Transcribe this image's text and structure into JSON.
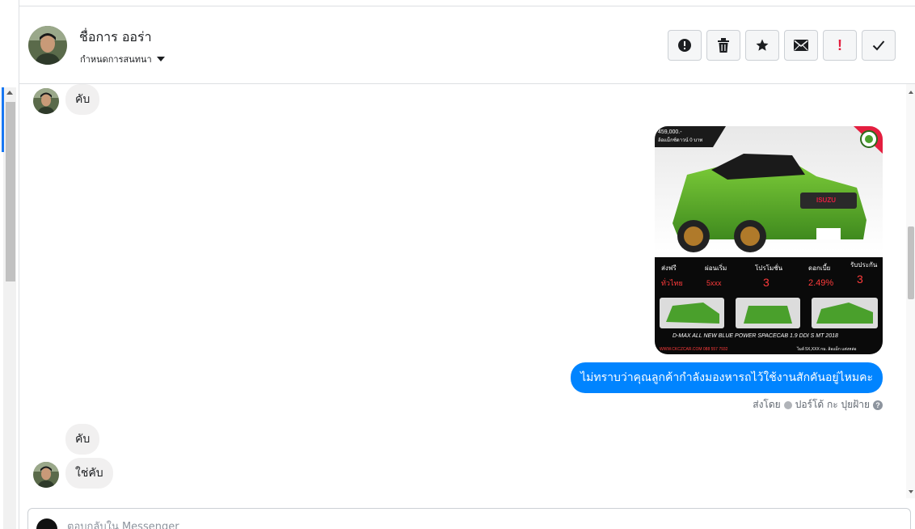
{
  "header": {
    "contact_name": "ชื่อการ ออร่า",
    "assign_label": "กำหนดการสนทนา"
  },
  "actions": [
    {
      "name": "report-spam-button",
      "icon": "alert-circle-icon"
    },
    {
      "name": "delete-button",
      "icon": "trash-icon"
    },
    {
      "name": "star-button",
      "icon": "star-icon"
    },
    {
      "name": "mark-unread-button",
      "icon": "envelope-icon"
    },
    {
      "name": "follow-up-button",
      "icon": "exclamation-icon"
    },
    {
      "name": "mark-done-button",
      "icon": "checkmark-icon"
    }
  ],
  "messages": {
    "in_1": "คับ",
    "out_text": "ไม่ทราบว่าคุณลูกค้ากำลังมองหารถไว้ใช้งานสักคันอยู่ไหมคะ",
    "in_2": "คับ",
    "in_3": "ใช่คับ"
  },
  "ad": {
    "price_top": "459,000.-",
    "price_sub": "ล้อแม็กซ์ดาวน์ 0 บาท",
    "brand": "ISUZU",
    "features": [
      {
        "label": "ส่งฟรี",
        "value": "ทั่วไทย"
      },
      {
        "label": "ผ่อนเริ่ม",
        "value": "5xxx"
      },
      {
        "label": "โปรโมชั่น",
        "value": "3"
      },
      {
        "label": "ดอกเบี้ย",
        "value": "2.49%"
      },
      {
        "label": "รับประกัน",
        "value": "3"
      }
    ],
    "model": "D-MAX ALL NEW BLUE POWER SPACECAB 1.9 DDI S MT 2018",
    "footer_left": "WWW.CKCZCAR.COM 088 557 7932",
    "footer_right": "ไมล์ 5X,XXX กม. ล้อแม็ก แต่งหล่อ"
  },
  "sent_meta": {
    "prefix": "ส่งโดย",
    "author": "ปอร์โด้ กะ ปุยฝ้าย",
    "help": "?"
  },
  "composer": {
    "placeholder": "ตอบกลับใน Messenger"
  },
  "colors": {
    "bubble_out": "#0084ff",
    "bubble_in": "#f1f0f0",
    "accent": "#1877f2",
    "follow_up_red": "#e41e3f",
    "car_green": "#4aa02c"
  }
}
